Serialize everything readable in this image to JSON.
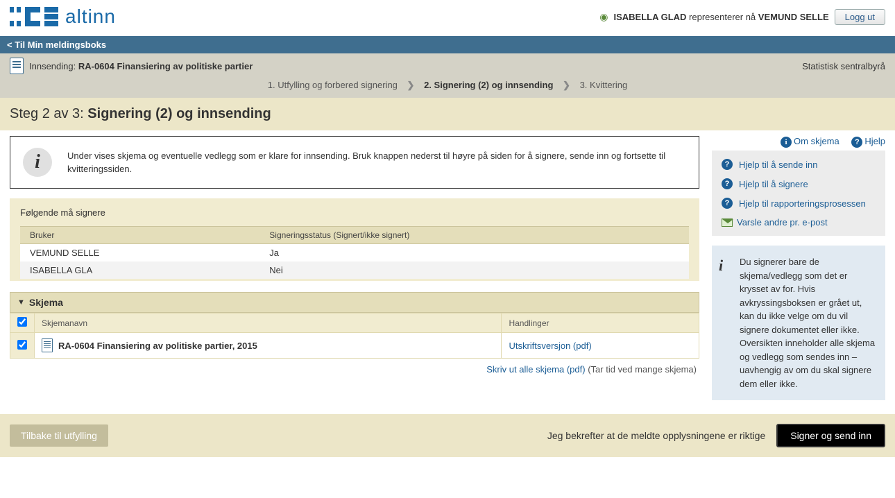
{
  "header": {
    "brand": "altinn",
    "user_prefix": "ISABELLA GLAD",
    "user_mid": " representerer nå ",
    "user_acting_as": "VEMUND SELLE",
    "logout": "Logg ut"
  },
  "nav": {
    "back": "< Til Min meldingsboks"
  },
  "context": {
    "label": "Innsending: ",
    "title": "RA-0604 Finansiering av politiske partier",
    "org": "Statistisk sentralbyrå",
    "steps": {
      "s1": "1. Utfylling og forbered signering",
      "s2": "2. Signering (2) og innsending",
      "s3": "3. Kvittering"
    }
  },
  "heading": {
    "prefix": "Steg 2 av 3: ",
    "title": "Signering (2) og innsending"
  },
  "top_links": {
    "about": "Om skjema",
    "help": "Hjelp"
  },
  "info": {
    "text": "Under vises skjema og eventuelle vedlegg som er klare for innsending. Bruk knappen nederst til høyre på siden for å signere, sende inn og fortsette til kvitteringssiden."
  },
  "signers": {
    "title": "Følgende må signere",
    "col_user": "Bruker",
    "col_status": "Signeringsstatus (Signert/ikke signert)",
    "rows": [
      {
        "user": "VEMUND SELLE",
        "status": "Ja"
      },
      {
        "user": "ISABELLA GLA",
        "status": "Nei"
      }
    ]
  },
  "forms": {
    "section": "Skjema",
    "col_name": "Skjemanavn",
    "col_actions": "Handlinger",
    "row_name": "RA-0604 Finansiering av politiske partier, 2015",
    "row_action": "Utskriftsversjon (pdf)"
  },
  "print": {
    "link": "Skriv ut alle skjema (pdf)",
    "hint": " (Tar tid ved mange skjema)"
  },
  "side_links": {
    "l1": "Hjelp til å sende inn",
    "l2": "Hjelp til å signere",
    "l3": "Hjelp til rapporteringsprosessen",
    "l4": "Varsle andre pr. e-post"
  },
  "side_info": {
    "text": "Du signerer bare de skjema/vedlegg som det er krysset av for. Hvis avkryssingsboksen er grået ut, kan du ikke velge om du vil signere dokumentet eller ikke. Oversikten inneholder alle skjema og vedlegg som sendes inn – uavhengig av om du skal signere dem eller ikke."
  },
  "footer": {
    "back": "Tilbake til utfylling",
    "confirm": "Jeg bekrefter at de meldte opplysningene er riktige",
    "submit": "Signer og send inn"
  }
}
